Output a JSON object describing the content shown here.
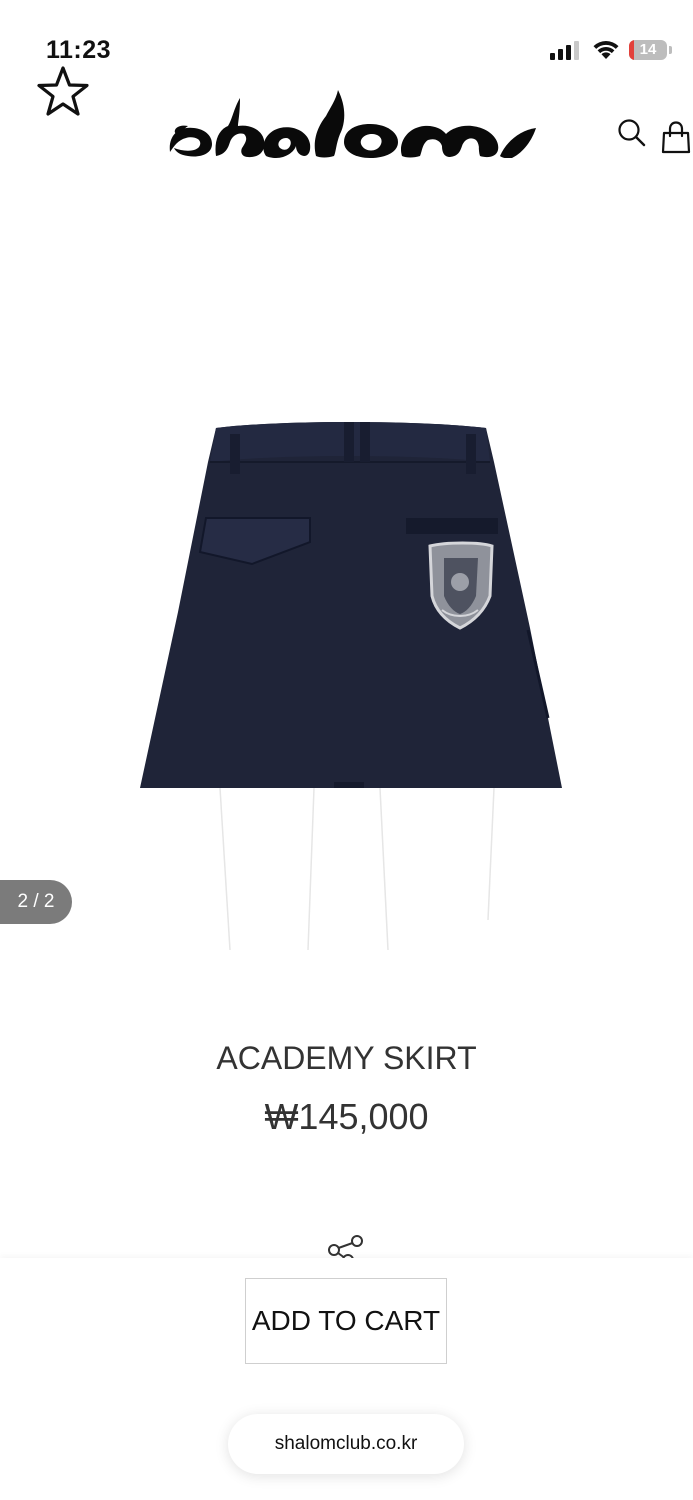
{
  "status_bar": {
    "time": "11:23",
    "battery_level": "14",
    "battery_fraction": 0.14,
    "battery_color": "#e2413b"
  },
  "header": {
    "logo_text": "shalom",
    "star_icon": "star-outline-icon",
    "search_icon": "search-icon",
    "bag_icon": "shopping-bag-icon"
  },
  "gallery": {
    "counter": "2 / 2",
    "counter_bg": "#7b7b7b",
    "image_icon": "navy-mini-skirt-back-view"
  },
  "product": {
    "name": "ACADEMY SKIRT",
    "price": "₩145,000",
    "share_icon": "share-icon"
  },
  "actions": {
    "add_to_cart": "ADD TO CART"
  },
  "browser": {
    "url": "shalomclub.co.kr"
  }
}
